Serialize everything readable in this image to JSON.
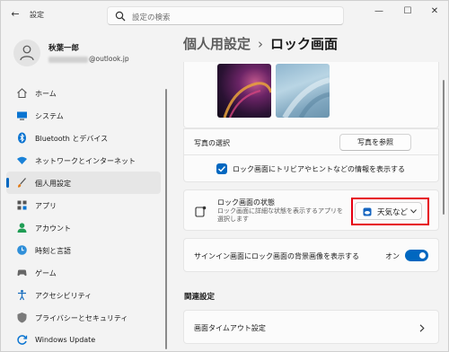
{
  "titlebar": {
    "app_title": "設定",
    "search_placeholder": "設定の検索",
    "minimize": "—",
    "maximize": "☐",
    "close": "✕"
  },
  "profile": {
    "name": "秋葉一郎",
    "email_suffix": "@outlook.jp"
  },
  "sidebar": {
    "items": [
      {
        "label": "ホーム",
        "icon": "home-icon"
      },
      {
        "label": "システム",
        "icon": "system-icon"
      },
      {
        "label": "Bluetooth とデバイス",
        "icon": "bluetooth-icon"
      },
      {
        "label": "ネットワークとインターネット",
        "icon": "network-icon"
      },
      {
        "label": "個人用設定",
        "icon": "brush-icon"
      },
      {
        "label": "アプリ",
        "icon": "apps-icon"
      },
      {
        "label": "アカウント",
        "icon": "account-icon"
      },
      {
        "label": "時刻と言語",
        "icon": "time-language-icon"
      },
      {
        "label": "ゲーム",
        "icon": "game-icon"
      },
      {
        "label": "アクセシビリティ",
        "icon": "accessibility-icon"
      },
      {
        "label": "プライバシーとセキュリティ",
        "icon": "shield-icon"
      },
      {
        "label": "Windows Update",
        "icon": "update-icon"
      }
    ],
    "active_index": 4
  },
  "header": {
    "crumb": "個人用設定",
    "separator": "›",
    "title": "ロック画面"
  },
  "picture": {
    "select_label": "写真の選択",
    "browse_button": "写真を参照",
    "trivia_checkbox_label": "ロック画面にトリビアやヒントなどの情報を表示する"
  },
  "status": {
    "title": "ロック画面の状態",
    "description": "ロック画面に詳細な状態を表示するアプリを選択します",
    "selected_value": "天気など"
  },
  "signin": {
    "label": "サインイン画面にロック画面の背景画像を表示する",
    "state": "オン"
  },
  "related": {
    "heading": "関連設定",
    "screen_timeout": "画面タイムアウト設定"
  },
  "colors": {
    "accent": "#0067c0",
    "highlight": "#e60012"
  }
}
